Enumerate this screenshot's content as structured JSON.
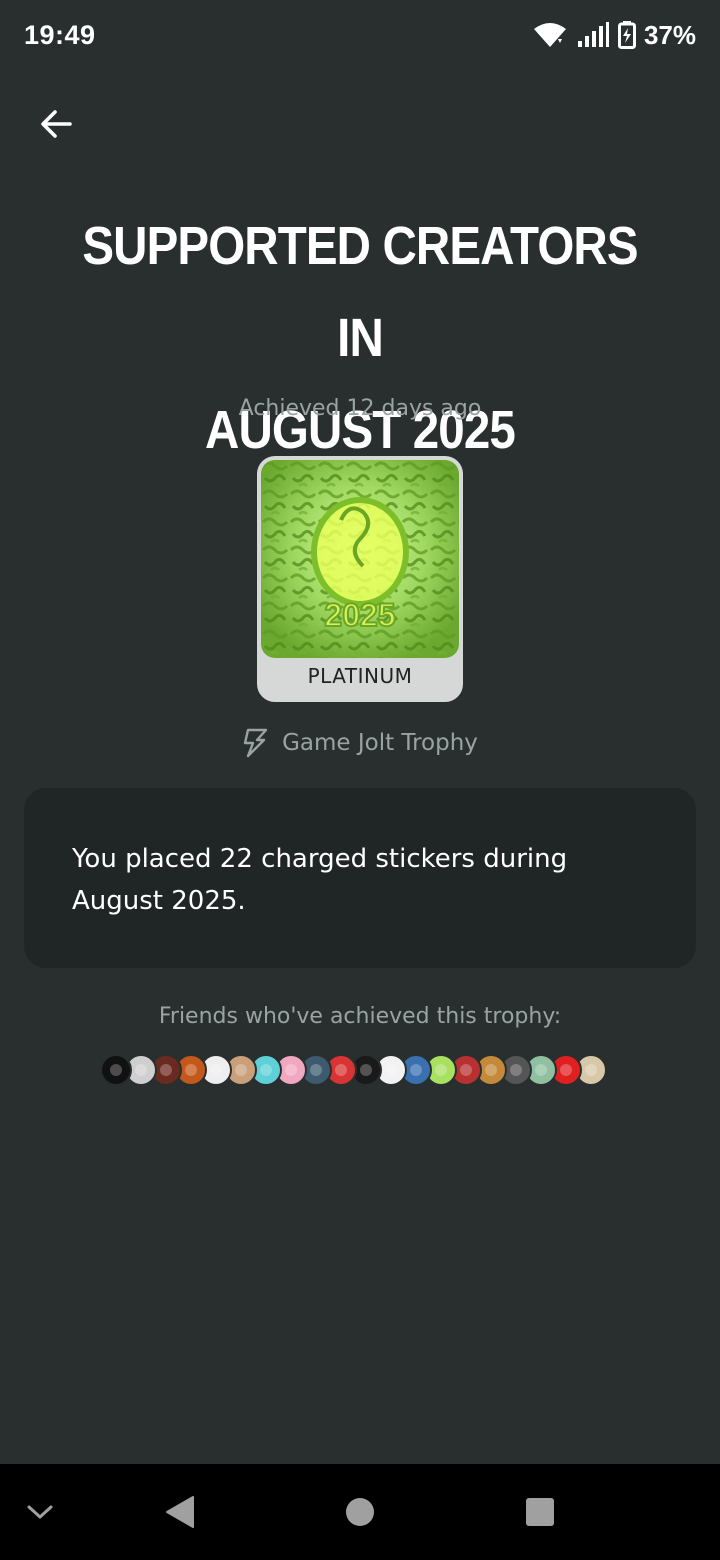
{
  "status_bar": {
    "time": "19:49",
    "battery": "37%"
  },
  "header": {
    "back_icon": "arrow-left-icon"
  },
  "trophy": {
    "title": "SUPPORTED CREATORS IN AUGUST 2025",
    "achieved": "Achieved 12 days ago",
    "tier": "PLATINUM",
    "image_text": "2025",
    "source_label": "Game Jolt Trophy",
    "source_icon": "lightning-bolt-icon",
    "description": "You placed 22 charged stickers during August 2025."
  },
  "friends": {
    "label": "Friends who've achieved this trophy:",
    "avatar_colors": [
      "#111111",
      "#cfcfcf",
      "#6b2a20",
      "#c4581a",
      "#eeeeee",
      "#c9a07a",
      "#5fd0d8",
      "#f0a8c0",
      "#3d5a6e",
      "#d93434",
      "#1a1a1a",
      "#f2f2f2",
      "#3a6fb0",
      "#a8e060",
      "#b83030",
      "#c48a3a",
      "#555555",
      "#8fc0a0",
      "#e02020",
      "#d8c8a8"
    ]
  },
  "colors": {
    "background": "#292f2f",
    "card": "#202626",
    "muted_text": "#9aa3a3",
    "trophy_green": "#b6f04a"
  }
}
